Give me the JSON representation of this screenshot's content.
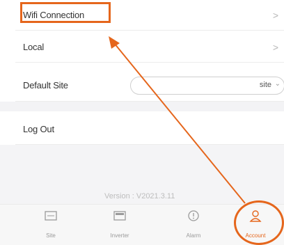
{
  "menu": {
    "wifi_label": "Wifi Connection",
    "local_label": "Local",
    "default_site_label": "Default Site",
    "default_site_value": "site",
    "logout_label": "Log Out"
  },
  "icons": {
    "chevron": "chevron-right-icon",
    "dropdown": "chevron-down-icon"
  },
  "version_text": "Version : V2021.3.11",
  "tabbar": {
    "site": "Site",
    "inverter": "Inverter",
    "alarm": "Alarm",
    "account": "Account"
  },
  "colors": {
    "accent": "#e5661c",
    "tab_inactive": "#9a9a9a"
  }
}
